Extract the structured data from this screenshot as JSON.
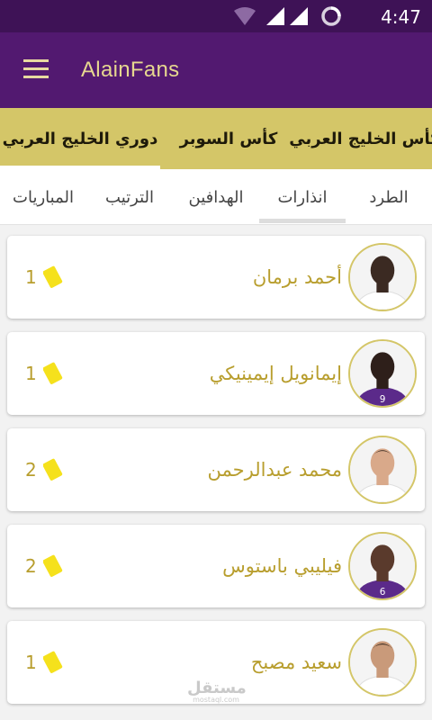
{
  "status_bar": {
    "time": "4:47",
    "icons": [
      "wifi-icon",
      "signal-icon",
      "signal-icon",
      "loading-circle-icon"
    ]
  },
  "app_bar": {
    "menu_icon": "hamburger-icon",
    "title": "AlainFans"
  },
  "competition_tabs": [
    {
      "label": "كأس الخليج العربي",
      "active": false
    },
    {
      "label": "كأس السوبر",
      "active": false
    },
    {
      "label": "دوري الخليج العربي",
      "active": true
    }
  ],
  "stat_tabs": [
    {
      "label": "الطرد",
      "active": false
    },
    {
      "label": "انذارات",
      "active": true
    },
    {
      "label": "الهدافين",
      "active": false
    },
    {
      "label": "الترتيب",
      "active": false
    },
    {
      "label": "المباريات",
      "active": false
    }
  ],
  "players": [
    {
      "name": "أحمد برمان",
      "count": "1",
      "icon": "yellow-card-icon",
      "kit": "white"
    },
    {
      "name": "إيمانويل إيمينيكي",
      "count": "1",
      "icon": "yellow-card-icon",
      "kit": "purple",
      "shirt": "9"
    },
    {
      "name": "محمد عبدالرحمن",
      "count": "2",
      "icon": "yellow-card-icon",
      "kit": "white"
    },
    {
      "name": "فيليبي باستوس",
      "count": "2",
      "icon": "yellow-card-icon",
      "kit": "purple",
      "shirt": "6"
    },
    {
      "name": "سعيد مصبح",
      "count": "1",
      "icon": "yellow-card-icon",
      "kit": "white"
    }
  ],
  "watermark": {
    "arabic": "مستقل",
    "latin": "mostaql.com"
  },
  "colors": {
    "purple_dark": "#3e1256",
    "purple": "#521970",
    "gold": "#d4c668",
    "name_gold": "#b89e2e",
    "card_yellow": "#f5e11c"
  }
}
